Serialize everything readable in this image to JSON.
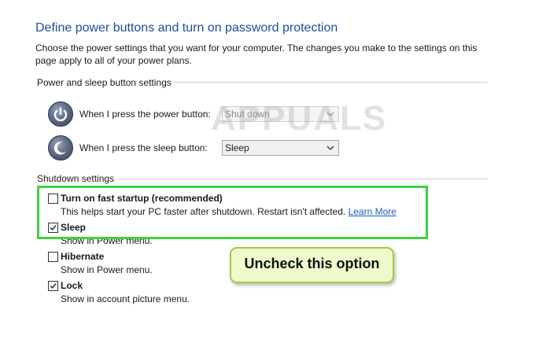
{
  "page": {
    "title": "Define power buttons and turn on password protection",
    "description": "Choose the power settings that you want for your computer. The changes you make to the settings on this page apply to all of your power plans."
  },
  "power_sleep": {
    "heading": "Power and sleep button settings",
    "power_button": {
      "label": "When I press the power button:",
      "value": "Shut down",
      "icon": "power-icon"
    },
    "sleep_button": {
      "label": "When I press the sleep button:",
      "value": "Sleep",
      "icon": "moon-icon"
    }
  },
  "shutdown": {
    "heading": "Shutdown settings",
    "options": [
      {
        "label": "Turn on fast startup (recommended)",
        "checked": false,
        "desc": "This helps start your PC faster after shutdown. Restart isn't affected.",
        "link": "Learn More"
      },
      {
        "label": "Sleep",
        "checked": true,
        "desc": "Show in Power menu."
      },
      {
        "label": "Hibernate",
        "checked": false,
        "desc": "Show in Power menu."
      },
      {
        "label": "Lock",
        "checked": true,
        "desc": "Show in account picture menu."
      }
    ]
  },
  "annotation": {
    "callout_text": "Uncheck this option",
    "highlight_color": "#3fd13f",
    "callout_bg": "#eef9cc"
  },
  "watermark": {
    "text": "APPUALS"
  }
}
